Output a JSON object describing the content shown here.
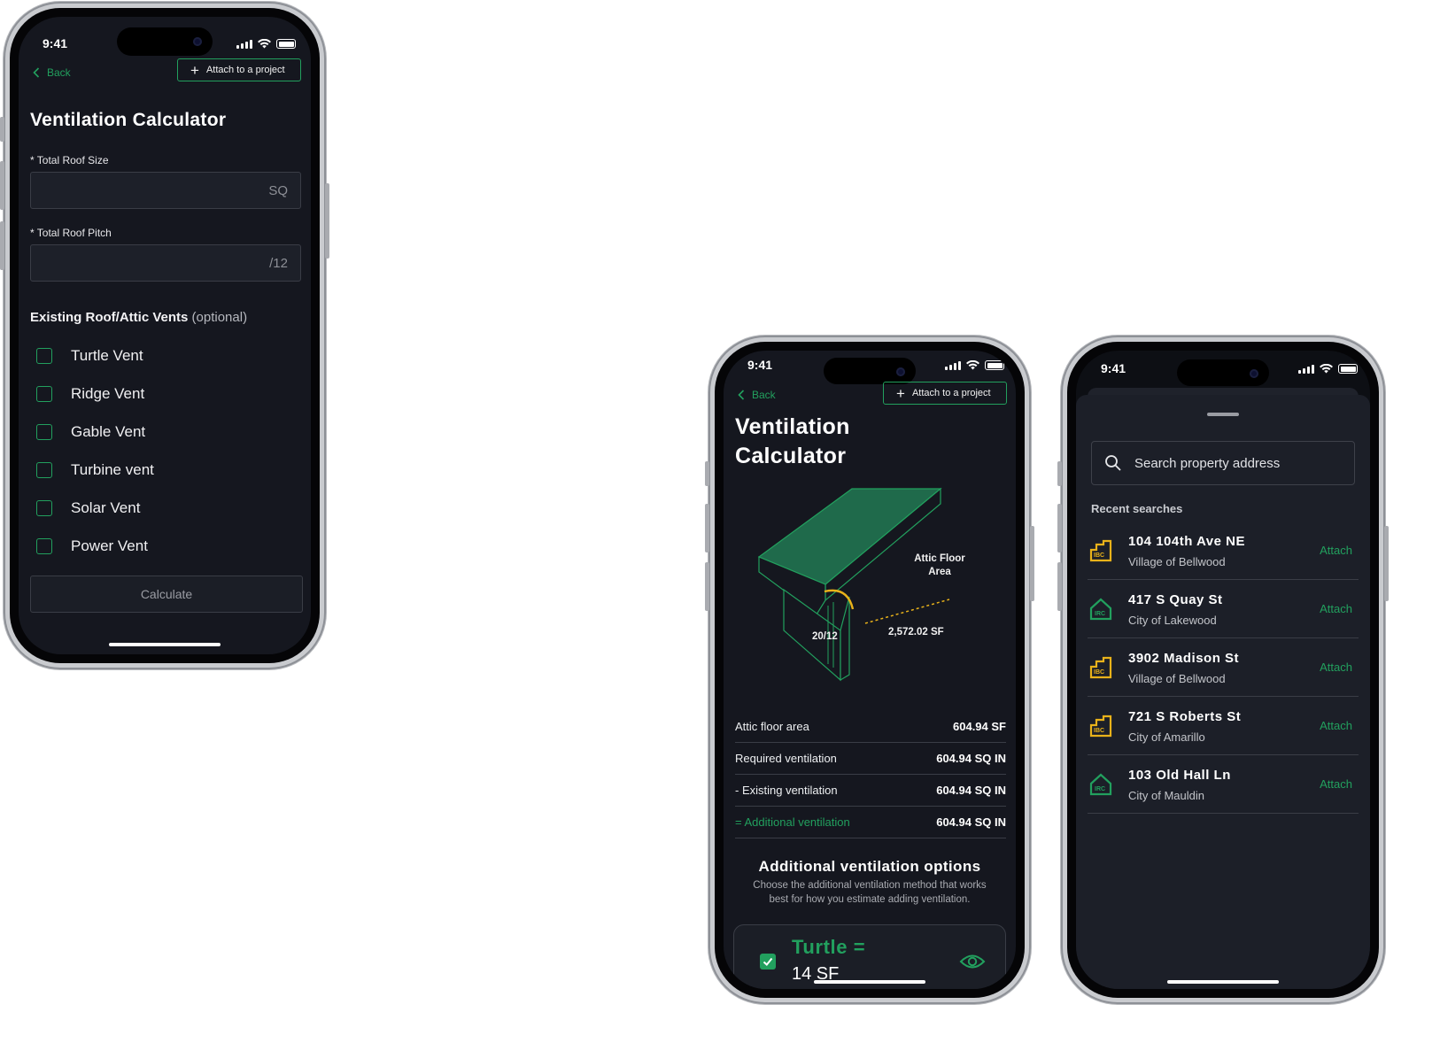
{
  "status": {
    "time": "9:41"
  },
  "colors": {
    "accent": "#22a05e",
    "background": "#15171f",
    "ibc": "#e9b21a"
  },
  "screen1": {
    "back_label": "Back",
    "attach_label": "Attach to a project",
    "title": "Ventilation Calculator",
    "roof_size": {
      "label": "* Total Roof Size",
      "value": "",
      "unit": "SQ"
    },
    "roof_pitch": {
      "label": "* Total Roof Pitch",
      "value": "",
      "unit": "/12"
    },
    "vents_heading": "Existing Roof/Attic Vents",
    "vents_optional": "(optional)",
    "vents": [
      "Turtle Vent",
      "Ridge Vent",
      "Gable Vent",
      "Turbine vent",
      "Solar Vent",
      "Power Vent"
    ],
    "calculate_label": "Calculate"
  },
  "screen2": {
    "back_label": "Back",
    "attach_label": "Attach to a project",
    "title_line1": "Ventilation",
    "title_line2": "Calculator",
    "diagram": {
      "area_label_1": "Attic Floor",
      "area_label_2": "Area",
      "pitch": "20/12",
      "area_value": "2,572.02 SF"
    },
    "results": [
      {
        "label": "Attic floor area",
        "value": "604.94 SF"
      },
      {
        "label": "Required ventilation",
        "value": "604.94 SQ IN"
      },
      {
        "label": "- Existing ventilation",
        "value": "604.94 SQ IN"
      },
      {
        "label": "= Additional ventilation",
        "value": "604.94 SQ IN"
      }
    ],
    "options_title": "Additional ventilation options",
    "options_desc_1": "Choose the additional ventilation method that works",
    "options_desc_2": "best for how you estimate adding ventilation.",
    "option": {
      "name": "Turtle =",
      "value": "14 SF"
    }
  },
  "screen3": {
    "search_placeholder": "Search property address",
    "recent_label": "Recent searches",
    "addresses": [
      {
        "street": "104 104th Ave NE",
        "city": "Village of Bellwood",
        "code": "IBC",
        "action": "Attach"
      },
      {
        "street": "417 S Quay St",
        "city": "City of Lakewood",
        "code": "IRC",
        "action": "Attach"
      },
      {
        "street": "3902 Madison St",
        "city": "Village of Bellwood",
        "code": "IBC",
        "action": "Attach"
      },
      {
        "street": "721 S Roberts St",
        "city": "City of Amarillo",
        "code": "IBC",
        "action": "Attach"
      },
      {
        "street": "103 Old Hall Ln",
        "city": "City of Mauldin",
        "code": "IRC",
        "action": "Attach"
      }
    ]
  }
}
